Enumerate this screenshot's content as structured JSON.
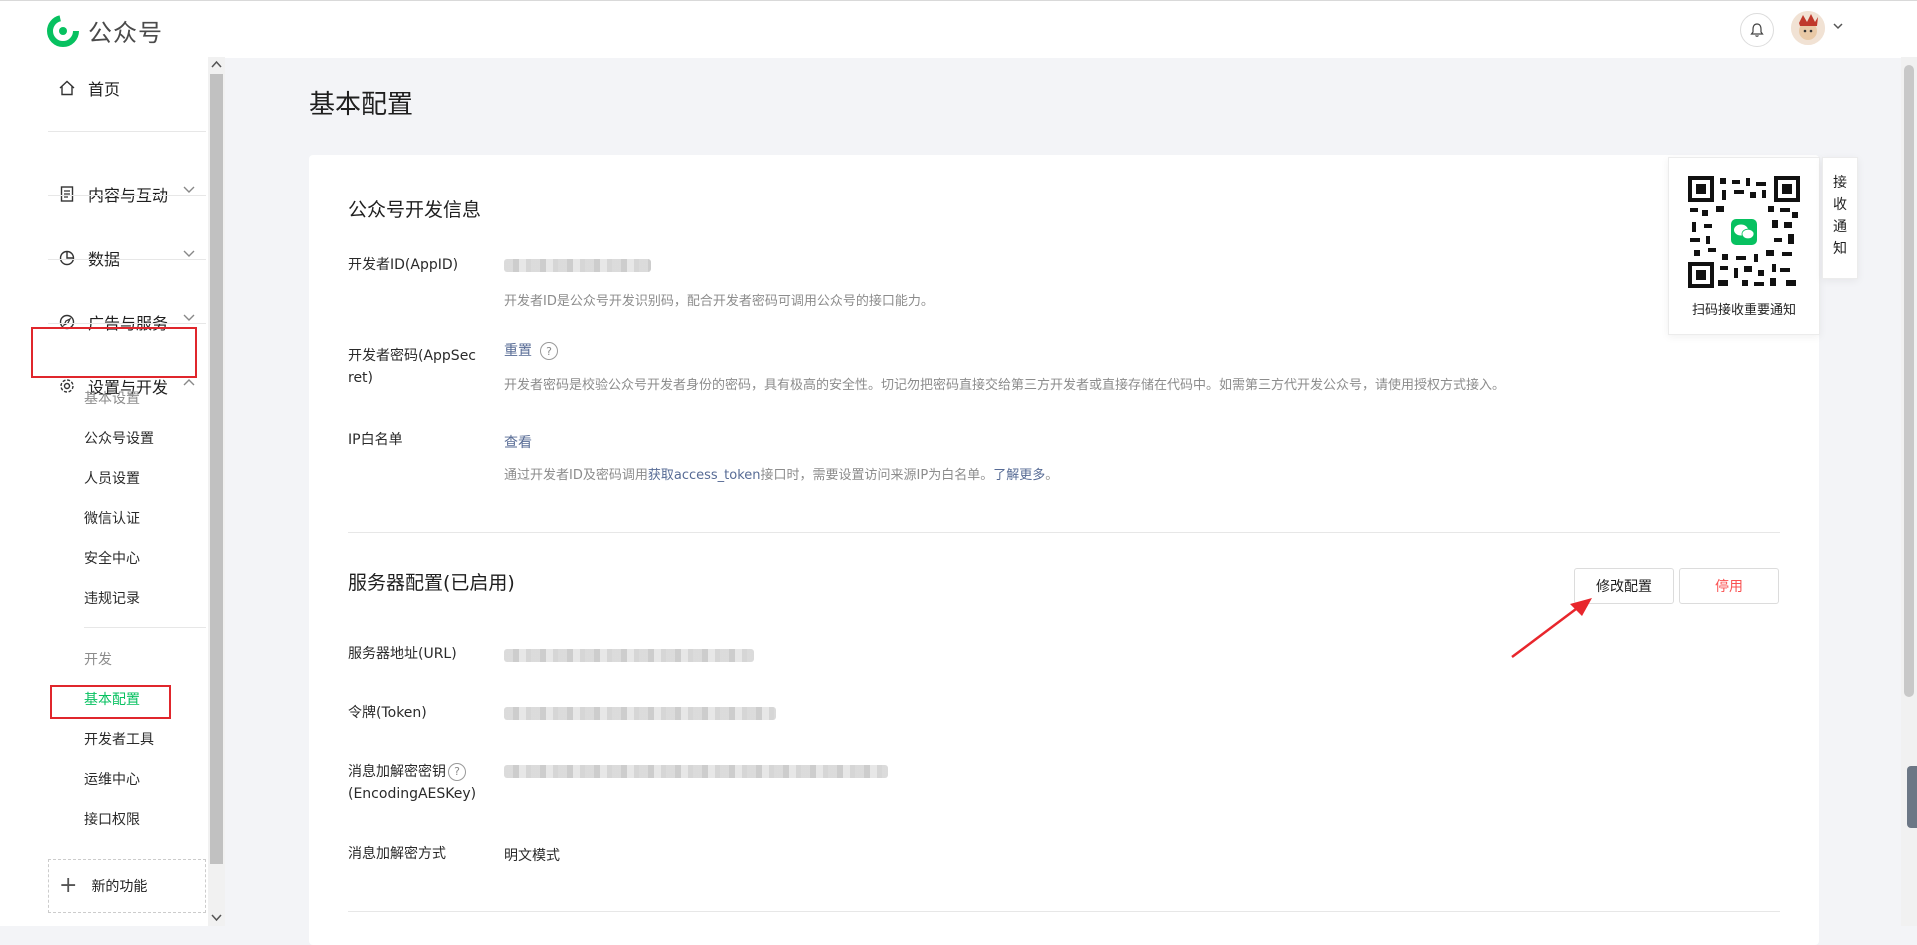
{
  "app": {
    "logo_text": "公众号",
    "brand_color": "#07c160"
  },
  "topbar": {
    "bell_icon": "bell-icon",
    "avatar_icon": "avatar-icon",
    "caret_icon": "chevron-down-icon"
  },
  "sidebar": {
    "items": [
      {
        "label": "首页",
        "icon": "home-icon"
      },
      {
        "label": "内容与互动",
        "icon": "document-icon"
      },
      {
        "label": "数据",
        "icon": "chart-pie-icon"
      },
      {
        "label": "广告与服务",
        "icon": "compass-icon"
      },
      {
        "label": "设置与开发",
        "icon": "gear-icon"
      }
    ],
    "settings_sub": [
      "基本设置",
      "公众号设置",
      "人员设置",
      "微信认证",
      "安全中心",
      "违规记录"
    ],
    "dev_group_label": "开发",
    "dev_sub": [
      "基本配置",
      "开发者工具",
      "运维中心",
      "接口权限"
    ],
    "new_feature": "新的功能"
  },
  "page": {
    "title": "基本配置"
  },
  "dev_info": {
    "title": "公众号开发信息",
    "appid_label": "开发者ID(AppID)",
    "appid_desc": "开发者ID是公众号开发识别码，配合开发者密码可调用公众号的接口能力。",
    "secret_label_line1": "开发者密码(AppSec",
    "secret_label_line2": "ret)",
    "secret_action": "重置",
    "secret_desc": "开发者密码是校验公众号开发者身份的密码，具有极高的安全性。切记勿把密码直接交给第三方开发者或直接存储在代码中。如需第三方代开发公众号，请使用授权方式接入。",
    "ip_label": "IP白名单",
    "ip_action": "查看",
    "ip_desc_prefix": "通过开发者ID及密码调用",
    "ip_desc_link": "获取access_token",
    "ip_desc_middle": "接口时，需要设置访问来源IP为白名单。",
    "ip_desc_more": "了解更多",
    "ip_desc_end": "。"
  },
  "server_config": {
    "title": "服务器配置(已启用)",
    "modify_button": "修改配置",
    "stop_button": "停用",
    "url_label": "服务器地址(URL)",
    "token_label": "令牌(Token)",
    "aes_label_line1": "消息加解密密钥",
    "aes_label_line2": "(EncodingAESKey)",
    "mode_label": "消息加解密方式",
    "mode_value": "明文模式"
  },
  "qr_panel": {
    "caption": "扫码接收重要通知",
    "vertical_text": "接收通知"
  }
}
